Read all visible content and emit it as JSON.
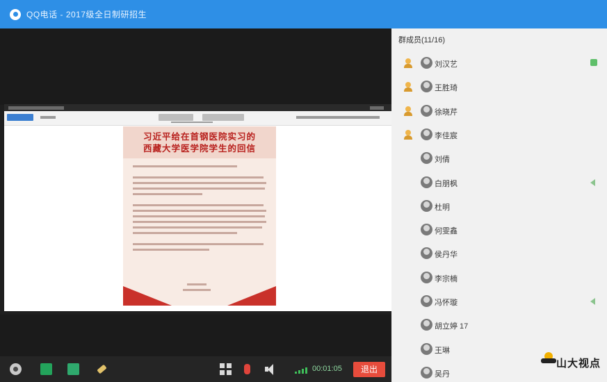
{
  "window": {
    "title": "QQ电话 - 2017级全日制研招生",
    "accent": "#2e8fe6"
  },
  "shared_screen": {
    "letter_title": [
      "习近平给在首钢医院实习的",
      "西藏大学医学院学生的回信"
    ],
    "colors": {
      "header_text": "#b8201d",
      "paper": "#f8ebe4",
      "ribbon": "#c9312a"
    }
  },
  "controls": {
    "icons": [
      "settings-icon",
      "screen-share-icon",
      "camera-icon",
      "brush-icon",
      "grid-icon",
      "mic-icon",
      "speaker-icon",
      "signal-icon"
    ],
    "timer": "00:01:05",
    "exit_label": "退出",
    "exit_color": "#e74c3c"
  },
  "members": {
    "header": "群成员(11/16)",
    "list": [
      {
        "name": "刘汉艺",
        "host": true,
        "indicator": "camera-icon"
      },
      {
        "name": "王胜琦",
        "host": true,
        "indicator": ""
      },
      {
        "name": "徐晓芹",
        "host": true,
        "indicator": ""
      },
      {
        "name": "李佳宸",
        "host": true,
        "indicator": ""
      },
      {
        "name": "刘倩",
        "host": false,
        "indicator": ""
      },
      {
        "name": "白朋枫",
        "host": false,
        "indicator": "volume-icon"
      },
      {
        "name": "杜明",
        "host": false,
        "indicator": ""
      },
      {
        "name": "何雯鑫",
        "host": false,
        "indicator": ""
      },
      {
        "name": "侯丹华",
        "host": false,
        "indicator": ""
      },
      {
        "name": "李宗楠",
        "host": false,
        "indicator": ""
      },
      {
        "name": "冯怀璇",
        "host": false,
        "indicator": "volume-icon"
      },
      {
        "name": "胡立婷 17",
        "host": false,
        "indicator": ""
      },
      {
        "name": "王琳",
        "host": false,
        "indicator": ""
      },
      {
        "name": "吴丹",
        "host": false,
        "indicator": ""
      }
    ]
  },
  "watermark": {
    "text": "山大视点"
  }
}
